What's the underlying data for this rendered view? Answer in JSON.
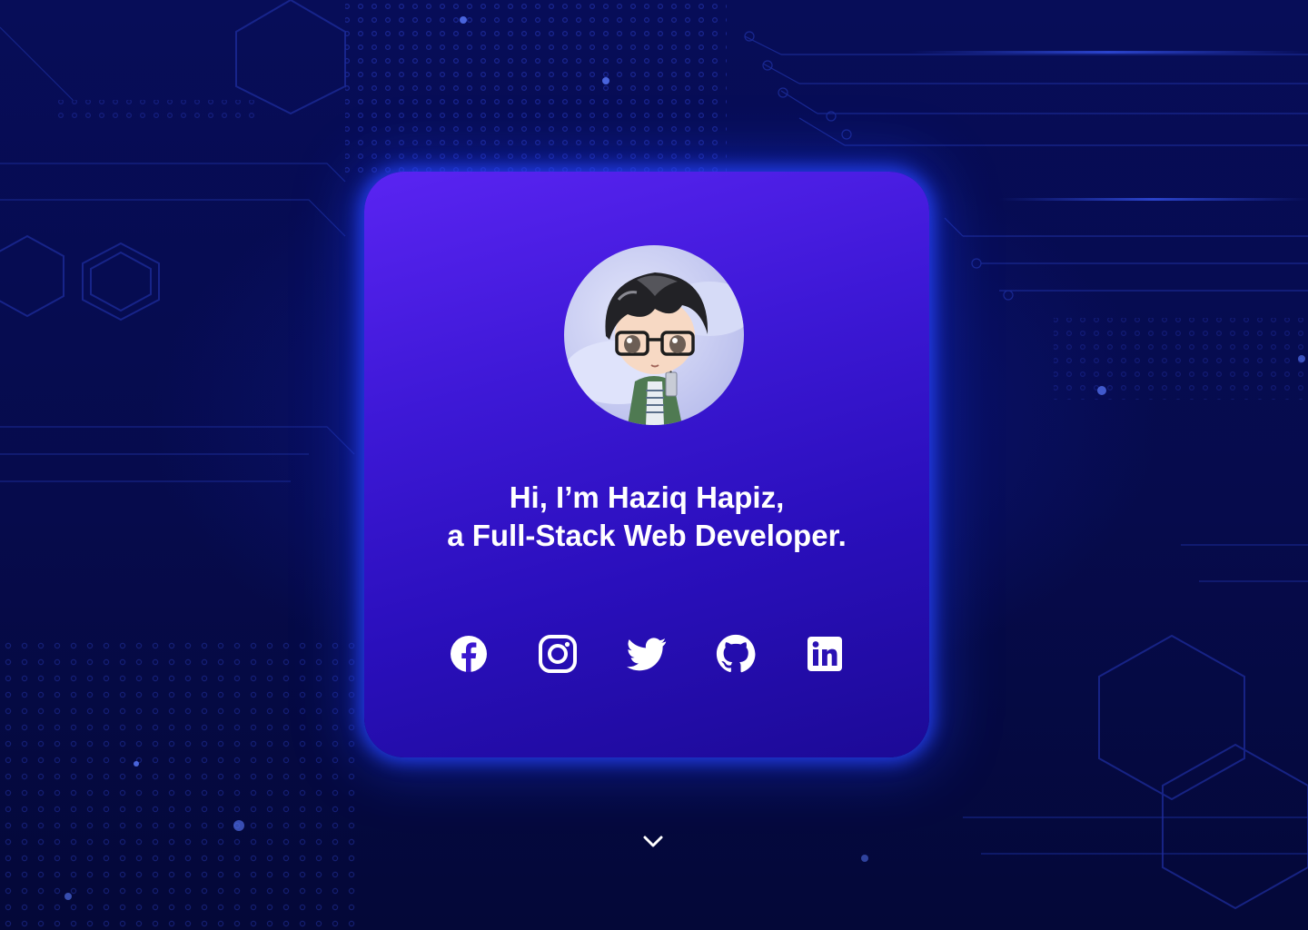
{
  "hero": {
    "line1": "Hi, I’m Haziq Hapiz,",
    "line2": "a Full-Stack Web Developer."
  },
  "socials": [
    {
      "name": "Facebook",
      "icon": "facebook-icon"
    },
    {
      "name": "Instagram",
      "icon": "instagram-icon"
    },
    {
      "name": "Twitter",
      "icon": "twitter-icon"
    },
    {
      "name": "GitHub",
      "icon": "github-icon"
    },
    {
      "name": "LinkedIn",
      "icon": "linkedin-icon"
    }
  ],
  "scroll": {
    "icon": "chevron-down-icon"
  },
  "colors": {
    "background": "#060b4c",
    "card_top": "#5a24f2",
    "card_bottom": "#1c0a96",
    "glow": "#2846ff",
    "text": "#ffffff"
  }
}
